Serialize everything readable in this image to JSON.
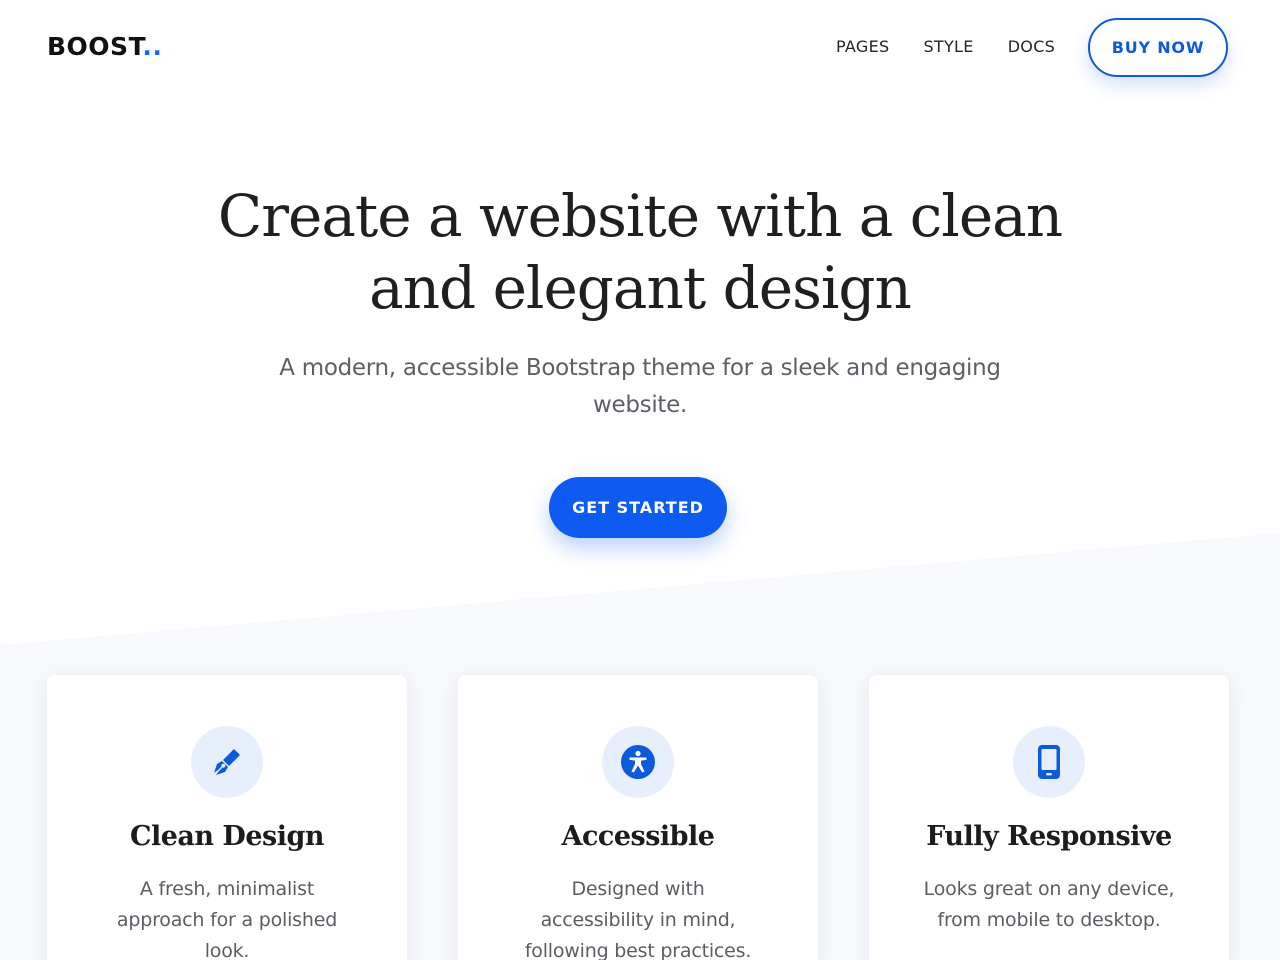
{
  "header": {
    "logo_text": "BOOST",
    "logo_dots": "..",
    "nav": {
      "pages": "PAGES",
      "style": "STYLE",
      "docs": "DOCS"
    },
    "buy_label": "BUY NOW"
  },
  "hero": {
    "title_line1": "Create a website with a clean",
    "title_line2": "and elegant design",
    "subtitle_line1": "A modern, accessible Bootstrap theme for a sleek and engaging",
    "subtitle_line2": "website.",
    "cta_label": "GET STARTED"
  },
  "features": [
    {
      "icon": "pen-nib-icon",
      "title": "Clean Design",
      "text": "A fresh, minimalist approach for a polished look."
    },
    {
      "icon": "accessibility-icon",
      "title": "Accessible",
      "text": "Designed with accessibility in mind, following best practices."
    },
    {
      "icon": "mobile-phone-icon",
      "title": "Fully Responsive",
      "text": "Looks great on any device, from mobile to desktop."
    }
  ],
  "colors": {
    "accent": "#0d5bf0",
    "outline": "#0d5bdb",
    "icon_bg": "#e8effc",
    "section_bg": "#f7f9fc"
  }
}
